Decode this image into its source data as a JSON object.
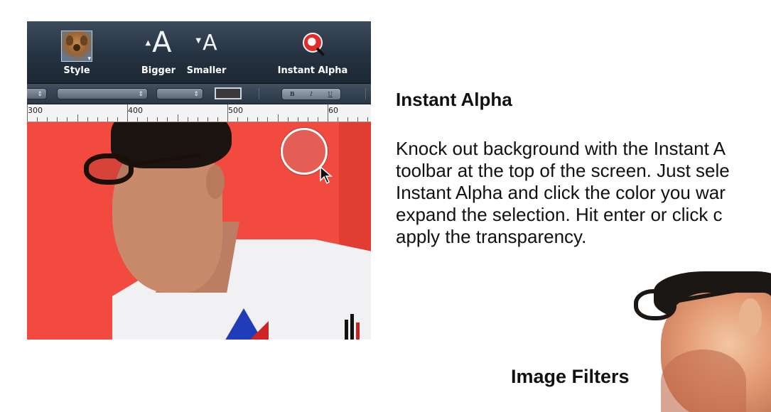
{
  "toolbar": {
    "style_label": "Style",
    "bigger_label": "Bigger",
    "bigger_glyph": "A",
    "smaller_label": "Smaller",
    "smaller_glyph": "A",
    "instant_alpha_label": "Instant Alpha"
  },
  "format_bar": {
    "bold": "B",
    "italic": "I",
    "underline": "U"
  },
  "ruler": {
    "marks": [
      "300",
      "400",
      "500",
      "60"
    ]
  },
  "content": {
    "heading": "Instant Alpha",
    "description_lines": [
      "Knock out background with the Instant A",
      "toolbar at the top of the screen. Just sele",
      "Instant Alpha and click the color you war",
      "expand the selection. Hit enter or click c",
      "apply the transparency."
    ],
    "caption": "Image Filters"
  },
  "colors": {
    "canvas_background": "#f24a3f",
    "toolbar_background": "#253241"
  }
}
